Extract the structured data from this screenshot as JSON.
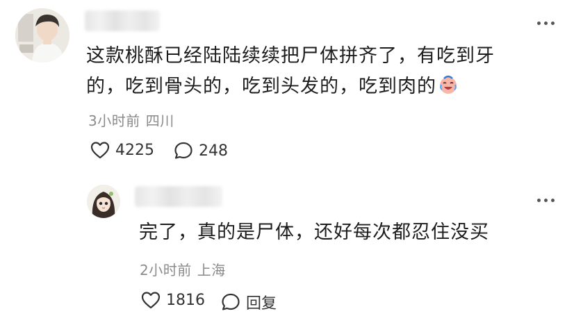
{
  "comment": {
    "text": "这款桃酥已经陆陆续续把尸体拼齐了，有吃到牙的，吃到骨头的，吃到头发的，吃到肉的",
    "emoji_icon": "crying-laughing-face-icon",
    "time": "3小时前",
    "location": "四川",
    "likes": "4225",
    "replies": "248"
  },
  "reply": {
    "text": "完了，真的是尸体，还好每次都忍住没买",
    "time": "2小时前",
    "location": "上海",
    "likes": "1816",
    "reply_label": "回复"
  },
  "colors": {
    "meta": "#8a8a8a",
    "icon": "#333333"
  }
}
